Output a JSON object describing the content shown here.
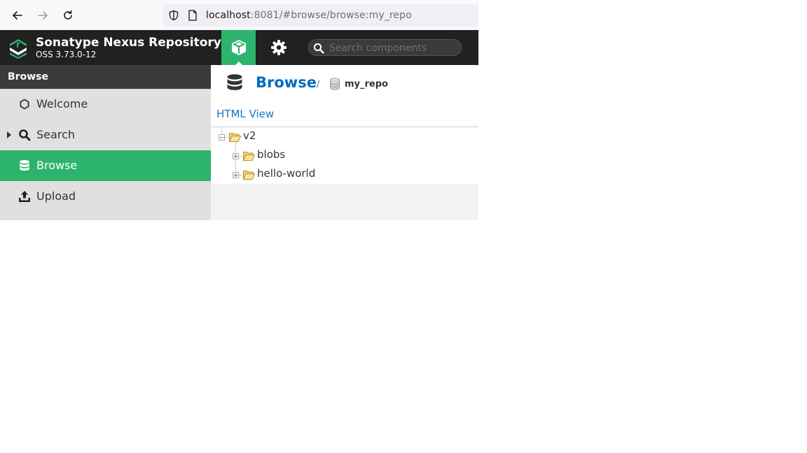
{
  "browser": {
    "url_host": "localhost",
    "url_rest": ":8081/#browse/browse:my_repo"
  },
  "header": {
    "title": "Sonatype Nexus Repository",
    "version": "OSS 3.73.0-12",
    "search_placeholder": "Search components",
    "accent_color": "#2db46c"
  },
  "sidebar": {
    "heading": "Browse",
    "items": [
      {
        "label": "Welcome",
        "icon": "hexagon-icon",
        "active": false
      },
      {
        "label": "Search",
        "icon": "search-icon",
        "active": false,
        "expandable": true
      },
      {
        "label": "Browse",
        "icon": "database-icon",
        "active": true
      },
      {
        "label": "Upload",
        "icon": "upload-icon",
        "active": false
      }
    ]
  },
  "main": {
    "breadcrumb_title": "Browse",
    "breadcrumb_sep": "/",
    "repo_name": "my_repo",
    "html_view_label": "HTML View",
    "tree": [
      {
        "name": "v2",
        "level": 0,
        "expanded": true
      },
      {
        "name": "blobs",
        "level": 1,
        "expanded": false
      },
      {
        "name": "hello-world",
        "level": 1,
        "expanded": false
      }
    ]
  }
}
